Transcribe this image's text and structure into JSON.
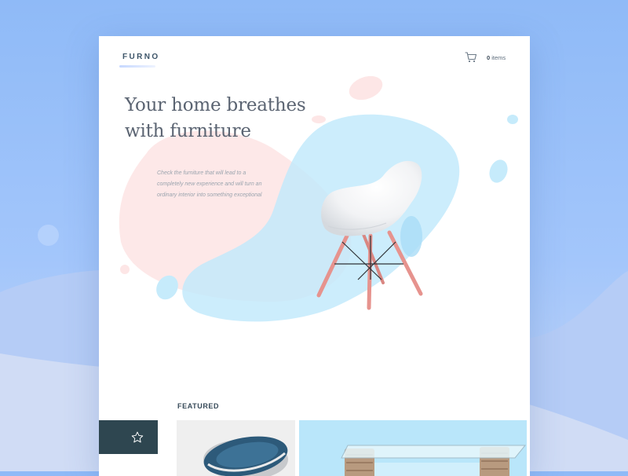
{
  "app": {
    "brand": "FURNO",
    "cart": {
      "count": "0",
      "label": "items"
    }
  },
  "hero": {
    "title_line1": "Your home breathes",
    "title_line2": "with furniture",
    "description": "Check the furniture that will lead to a completely new experience and will turn an ordinary interior into something exceptional"
  },
  "featured": {
    "label": "FEATURED",
    "products": [
      {
        "name": "round-lounge-chair"
      },
      {
        "name": "glass-wicker-table"
      }
    ]
  },
  "colors": {
    "background": "#9cc2f8",
    "card": "#ffffff",
    "title_text": "#5b6472",
    "pink_blob": "#fde8e8",
    "blue_blob": "#c6ebfb",
    "dark_accent": "#2e4650",
    "chair_leg": "#e6938e"
  },
  "icons": {
    "cart": "cart-icon",
    "favorite": "star-icon"
  }
}
